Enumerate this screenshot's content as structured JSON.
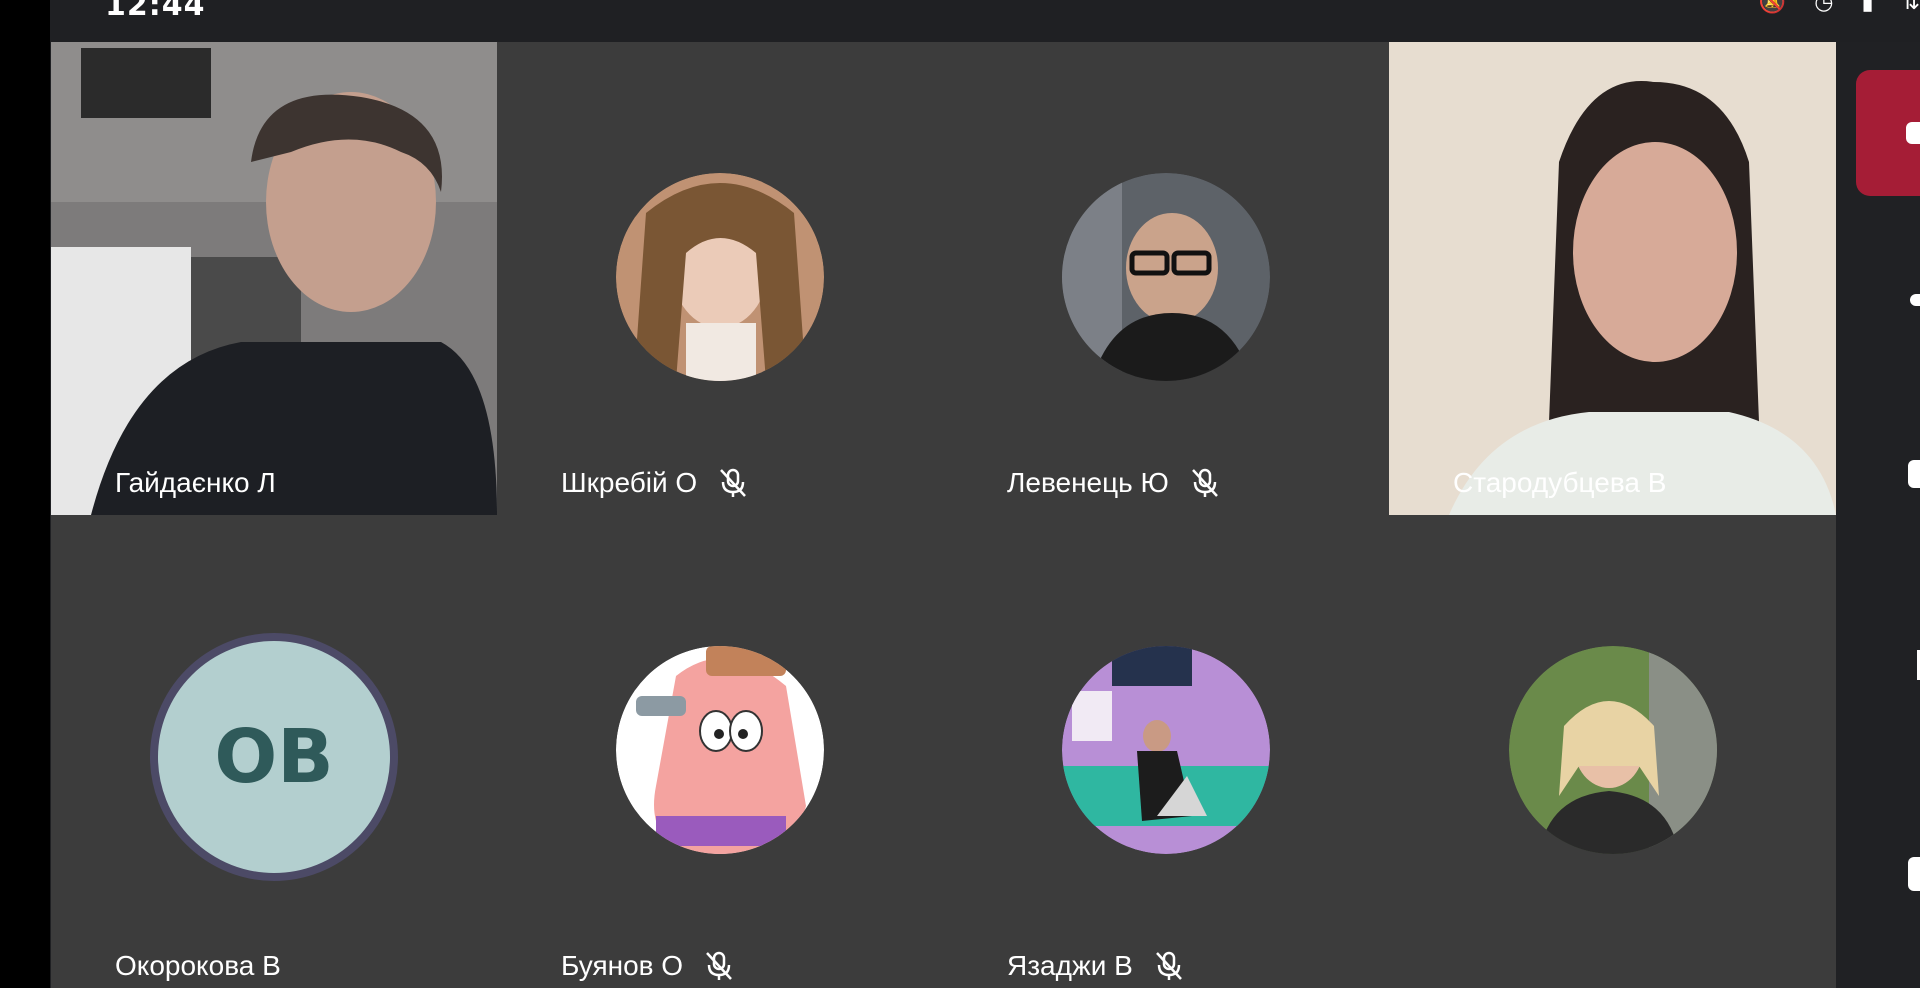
{
  "status_bar": {
    "clock": "12:44",
    "icons": [
      "mute-notifications-icon",
      "alarm-icon",
      "signal-icon",
      "wifi-icon"
    ]
  },
  "participants": [
    {
      "name": "Гайдаєнко Л",
      "muted": false,
      "view": "video",
      "scene": "young man in dark sweater, room with ceiling lamp"
    },
    {
      "name": "Шкребій О",
      "muted": true,
      "view": "avatar",
      "avatar_colors": [
        "#d8b394",
        "#7a5634",
        "#f1e9e2"
      ]
    },
    {
      "name": "Левенець Ю",
      "muted": true,
      "view": "avatar",
      "avatar_colors": [
        "#5d6268",
        "#1b1b1b",
        "#caa38b"
      ]
    },
    {
      "name": "Стародубцева В",
      "muted": false,
      "view": "video",
      "scene": "woman with dark hair, light wall background"
    },
    {
      "name": "Окорокова В",
      "muted": false,
      "view": "initials",
      "initials": "OB"
    },
    {
      "name": "Буянов О",
      "muted": true,
      "view": "avatar",
      "avatar_colors": [
        "#f4a3a0",
        "#ffffff",
        "#9a5bbd"
      ]
    },
    {
      "name": "Язаджи В",
      "muted": true,
      "view": "avatar",
      "avatar_colors": [
        "#b88fd6",
        "#2fb7a1",
        "#25324d"
      ]
    },
    {
      "name": "",
      "muted": false,
      "view": "avatar",
      "avatar_colors": [
        "#6a8a4a",
        "#e8d3a4",
        "#2a2a2a"
      ]
    }
  ],
  "colors": {
    "tile_bg": "#3c3c3c",
    "panel_bg": "#202124",
    "accent": "#a51d36",
    "initials_avatar_bg": "#b3cfcf",
    "initials_avatar_border": "#4c4a66"
  },
  "right_panel": {
    "buttons": [
      "raise-hand-button",
      "chat-button",
      "people-button",
      "mic-button",
      "camera-button"
    ]
  }
}
